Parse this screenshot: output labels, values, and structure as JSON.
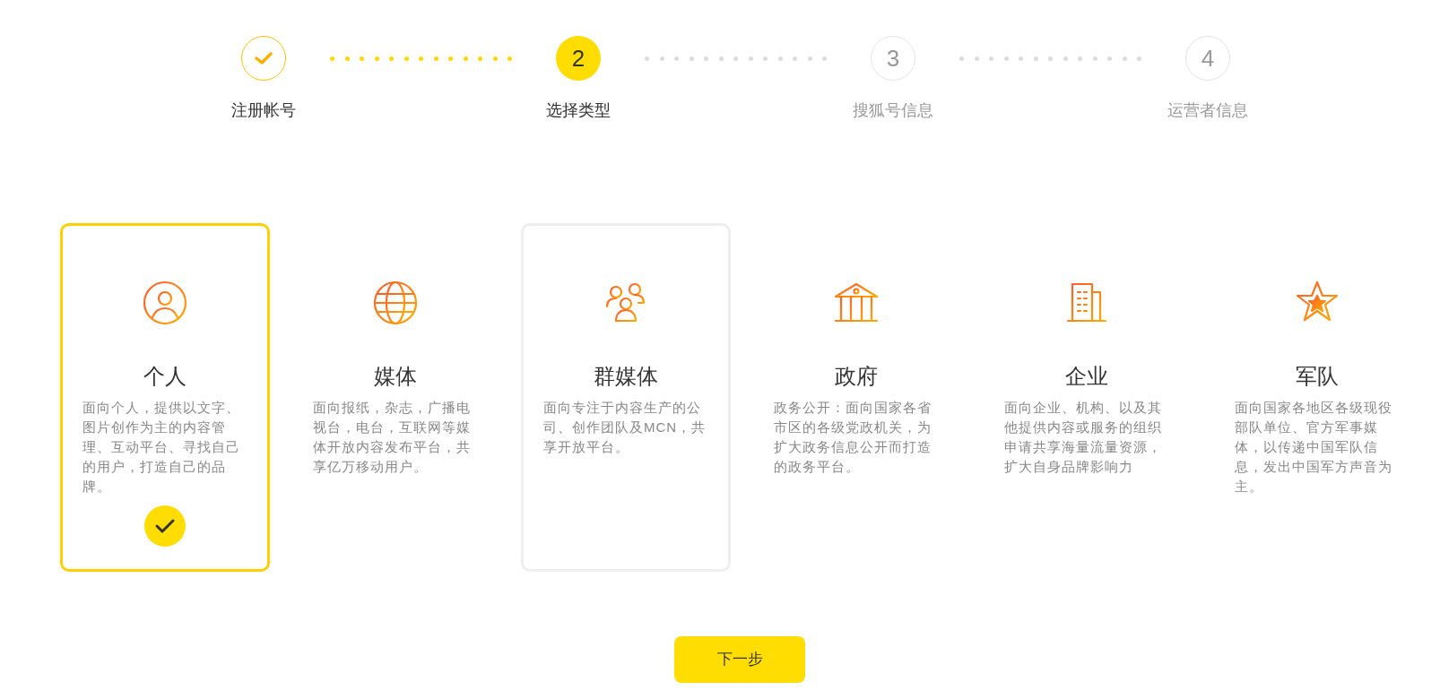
{
  "steps": [
    {
      "label": "注册帐号",
      "completed": true,
      "selected": false
    },
    {
      "number": "2",
      "label": "选择类型",
      "completed": false,
      "selected": true
    },
    {
      "number": "3",
      "label": "搜狐号信息",
      "completed": false,
      "selected": false
    },
    {
      "number": "4",
      "label": "运营者信息",
      "completed": false,
      "selected": false
    }
  ],
  "types": [
    {
      "kind": "person",
      "title": "个人",
      "description": "面向个人，提供以文字、图片创作为主的内容管理、互动平台、寻找自己的用户，打造自己的品牌。",
      "selected": true,
      "hovered": false
    },
    {
      "kind": "globe",
      "title": "媒体",
      "description": "面向报纸，杂志，广播电视台，电台，互联网等媒体开放内容发布平台，共享亿万移动用户。",
      "selected": false,
      "hovered": false
    },
    {
      "kind": "group",
      "title": "群媒体",
      "description": "面向专注于内容生产的公司、创作团队及MCN，共享开放平台。",
      "selected": false,
      "hovered": true
    },
    {
      "kind": "building",
      "title": "政府",
      "description": "政务公开：面向国家各省市区的各级党政机关，为扩大政务信息公开而打造的政务平台。",
      "selected": false,
      "hovered": false
    },
    {
      "kind": "office",
      "title": "企业",
      "description": "面向企业、机构、以及其他提供内容或服务的组织申请共享海量流量资源，扩大自身品牌影响力",
      "selected": false,
      "hovered": false
    },
    {
      "kind": "star",
      "title": "军队",
      "description": "面向国家各地区各级现役部队单位、官方军事媒体，以传递中国军队信息，发出中国军方声音为主。",
      "selected": false,
      "hovered": false
    }
  ],
  "next_button": "下一步"
}
